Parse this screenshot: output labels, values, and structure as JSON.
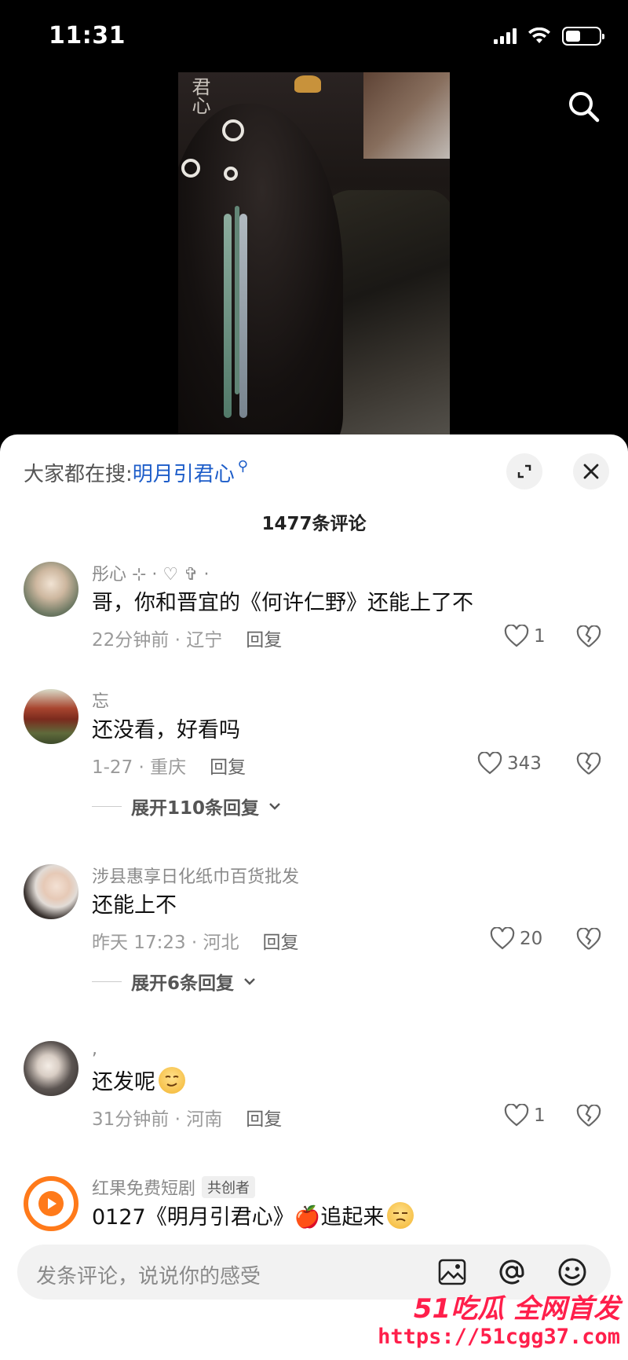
{
  "status_bar": {
    "time": "11:31"
  },
  "video": {
    "watermark": "君心"
  },
  "panel": {
    "hot_search_prefix": "大家都在搜:",
    "hot_search_keyword": "明月引君心",
    "comment_count": "1477条评论"
  },
  "comments": [
    {
      "user": "彤心 ⊹ · ♡ ✞ ·",
      "text": "哥，你和晋宜的《何许仁野》还能上了不",
      "meta": "22分钟前 · 辽宁",
      "reply": "回复",
      "likes": "1"
    },
    {
      "user": "忘",
      "text": "还没看，好看吗",
      "meta": "1-27 · 重庆",
      "reply": "回复",
      "likes": "343",
      "expand": "展开110条回复"
    },
    {
      "user": "涉县惠享日化纸巾百货批发",
      "text": "还能上不",
      "meta": "昨天 17:23 · 河北",
      "reply": "回复",
      "likes": "20",
      "expand": "展开6条回复"
    },
    {
      "user": ",",
      "text": "还发呢",
      "meta": "31分钟前 · 河南",
      "reply": "回复",
      "likes": "1"
    },
    {
      "user": "红果免费短剧",
      "badge": "共创者",
      "text": "0127《明月引君心》🍎追起来"
    }
  ],
  "input": {
    "placeholder": "发条评论，说说你的感受"
  },
  "site_mark": {
    "title": "51吃瓜 全网首发",
    "url": "https://51cgg37.com"
  },
  "colors": {
    "keyword": "#1d5dc9",
    "site_mark": "#ff1f4b",
    "hongguo_orange": "#ff7a1a"
  }
}
